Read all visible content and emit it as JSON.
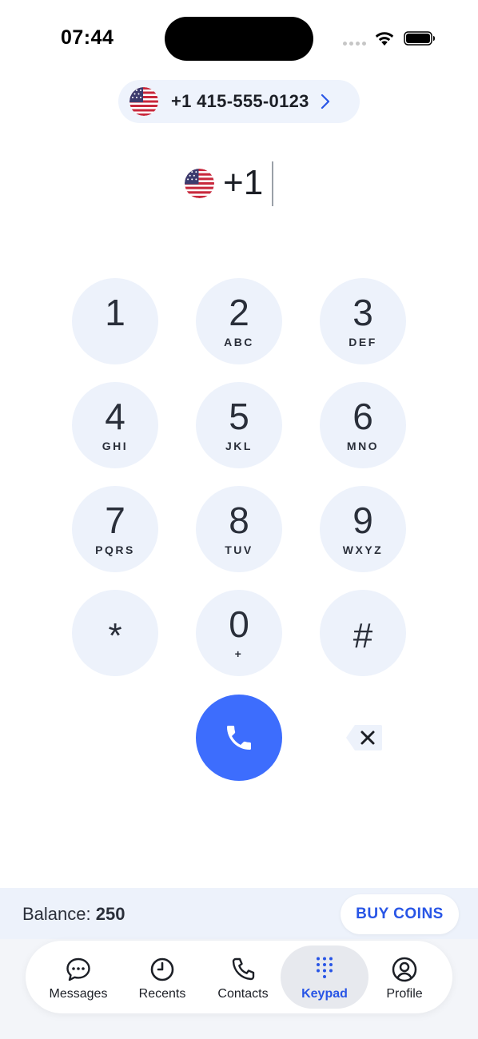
{
  "status_bar": {
    "time": "07:44"
  },
  "caller_id": {
    "number": "+1 415-555-0123",
    "flag_icon": "us-flag-icon"
  },
  "dialer": {
    "country_code": "+1",
    "flag_icon": "us-flag-icon"
  },
  "keypad": {
    "keys": [
      {
        "digit": "1",
        "letters": ""
      },
      {
        "digit": "2",
        "letters": "ABC"
      },
      {
        "digit": "3",
        "letters": "DEF"
      },
      {
        "digit": "4",
        "letters": "GHI"
      },
      {
        "digit": "5",
        "letters": "JKL"
      },
      {
        "digit": "6",
        "letters": "MNO"
      },
      {
        "digit": "7",
        "letters": "PQRS"
      },
      {
        "digit": "8",
        "letters": "TUV"
      },
      {
        "digit": "9",
        "letters": "WXYZ"
      },
      {
        "digit": "*",
        "letters": ""
      },
      {
        "digit": "0",
        "letters": "+"
      },
      {
        "digit": "#",
        "letters": ""
      }
    ]
  },
  "balance": {
    "label": "Balance:",
    "value": "250",
    "buy_label": "BUY COINS"
  },
  "tabs": [
    {
      "label": "Messages",
      "icon": "message-bubble-icon",
      "active": false
    },
    {
      "label": "Recents",
      "icon": "clock-icon",
      "active": false
    },
    {
      "label": "Contacts",
      "icon": "phone-icon",
      "active": false
    },
    {
      "label": "Keypad",
      "icon": "keypad-dots-icon",
      "active": true
    },
    {
      "label": "Profile",
      "icon": "user-circle-icon",
      "active": false
    }
  ],
  "colors": {
    "accent": "#3d6dfd",
    "accent_text": "#2855e6",
    "key_bg": "#edf2fb"
  }
}
